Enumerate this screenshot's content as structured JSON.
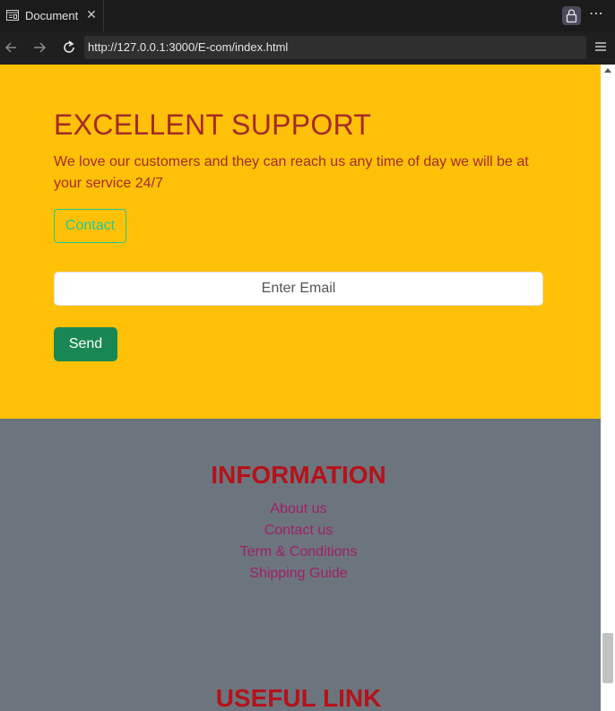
{
  "browser": {
    "tab_title": "Document",
    "tab_close": "✕",
    "more_label": "⋯",
    "url": "http://127.0.0.1:3000/E-com/index.html"
  },
  "support": {
    "title": "EXCELLENT SUPPORT",
    "text": "We love our customers and they can reach us any time of day we will be at your service 24/7",
    "contact_label": "Contact",
    "email_placeholder": "Enter Email",
    "send_label": "Send"
  },
  "footer": {
    "info_title": "INFORMATION",
    "links": [
      "About us",
      "Contact us",
      "Term & Conditions",
      "Shipping Guide"
    ],
    "useful_title": "USEFUL LINK"
  },
  "colors": {
    "support_bg": "#ffc107",
    "footer_bg": "#6c757d",
    "heading": "#a52a2a",
    "link": "#a0206a",
    "send_button": "#198754",
    "contact_outline": "#20c997"
  }
}
